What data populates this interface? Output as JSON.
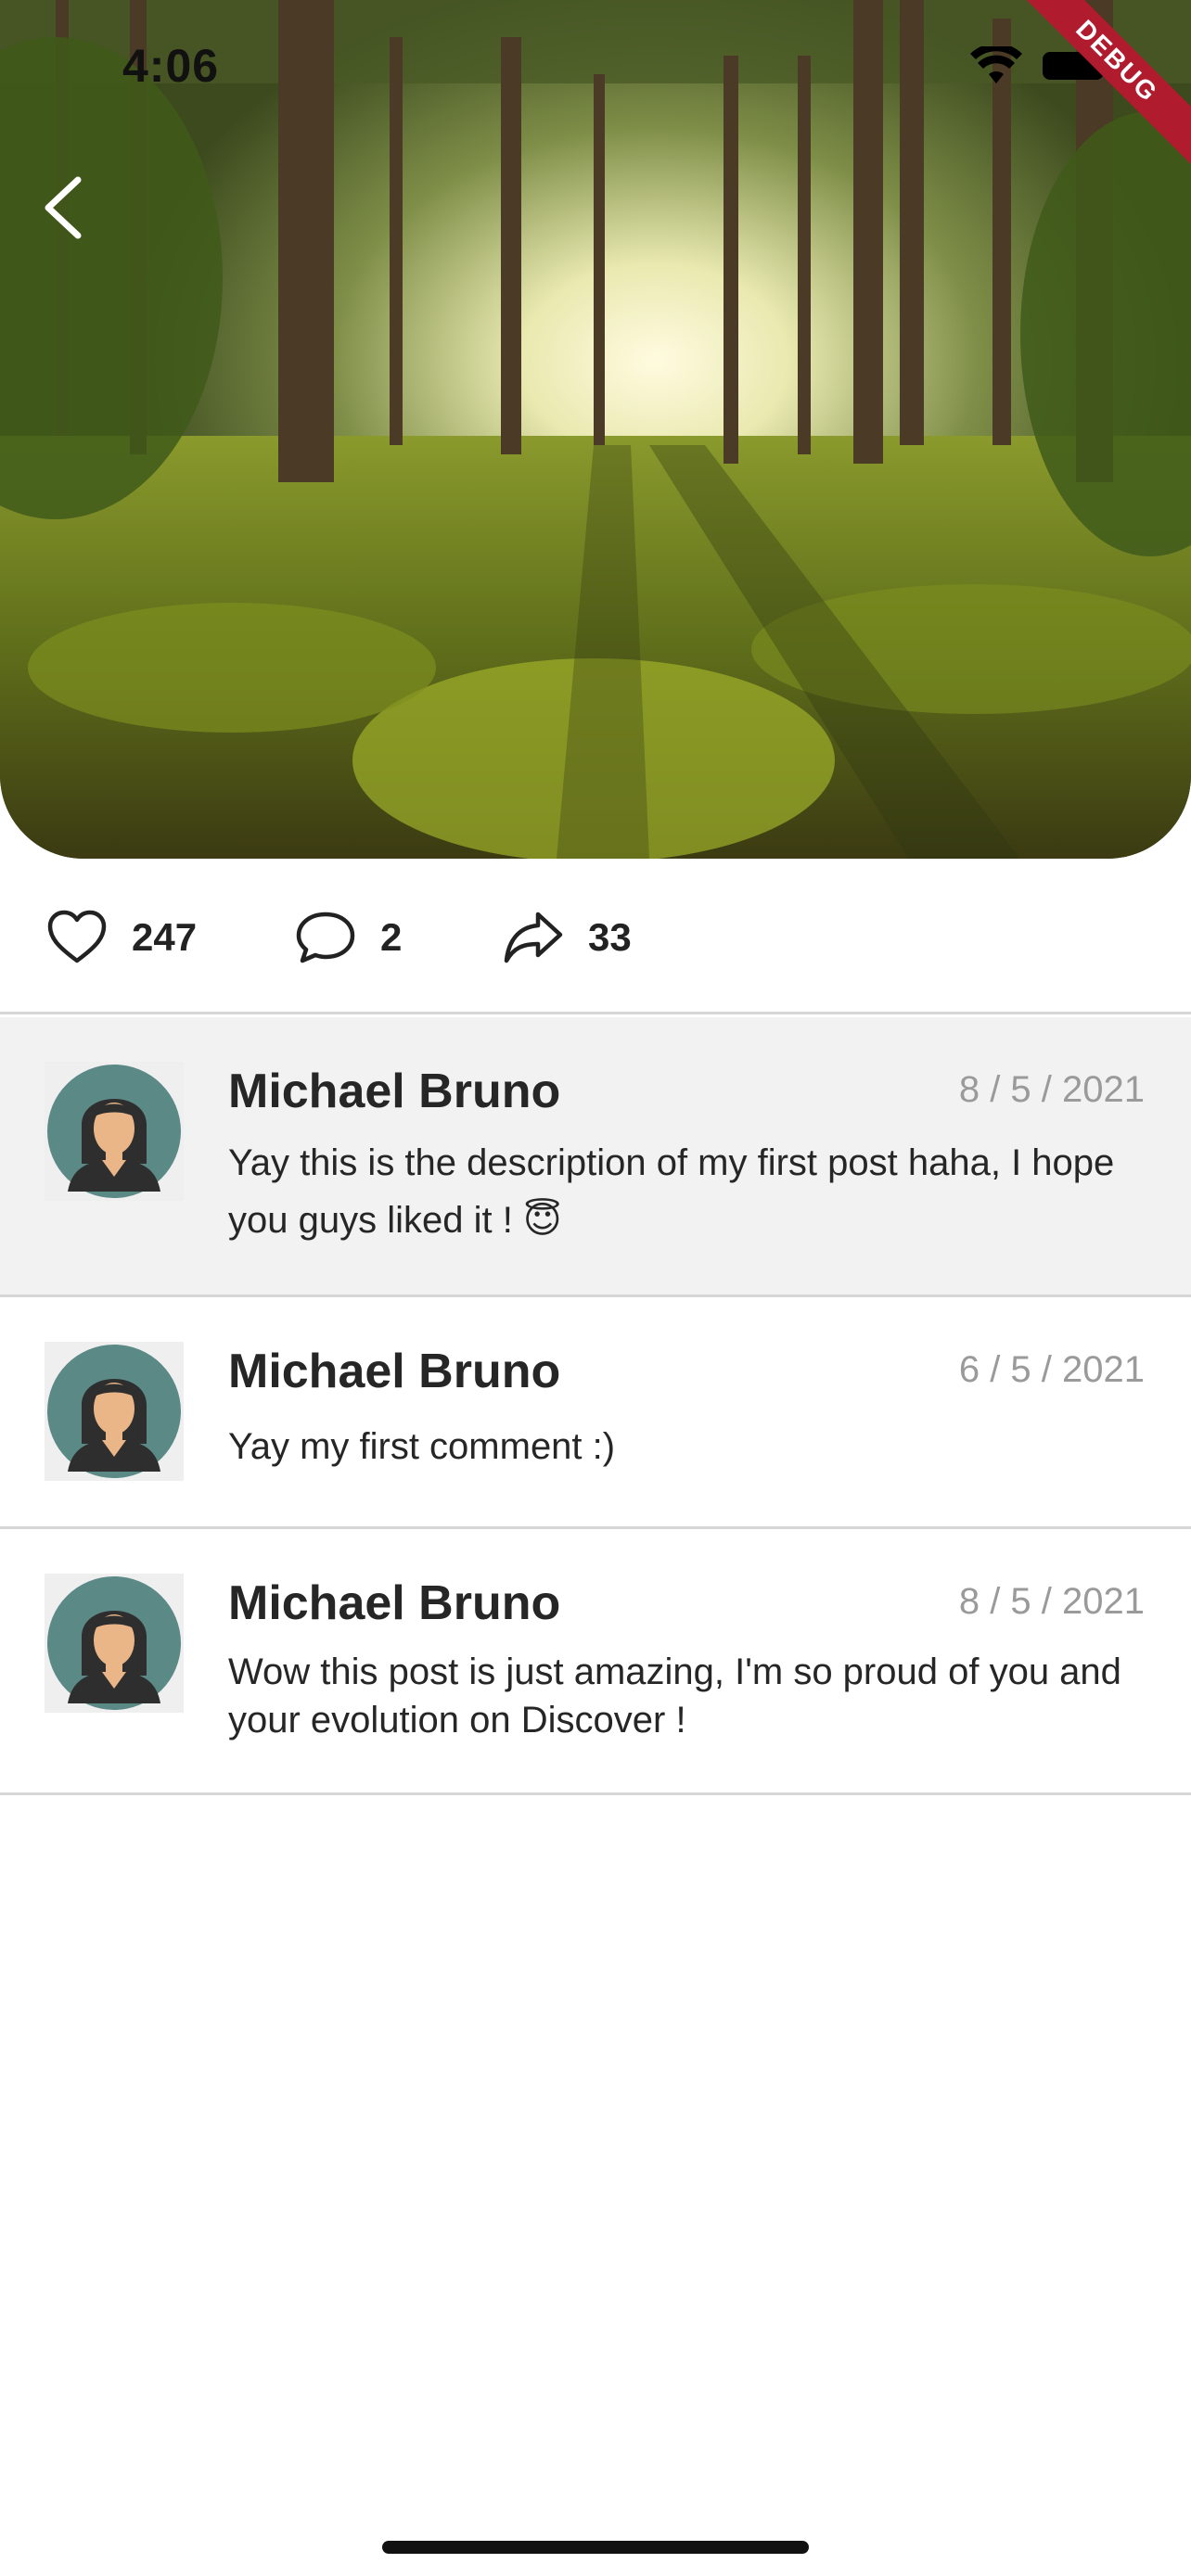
{
  "status_bar": {
    "time": "4:06",
    "debug_label": "DEBUG"
  },
  "post": {
    "image_icon": "forest-photo",
    "actions": {
      "likes": "247",
      "comments": "2",
      "shares": "33"
    }
  },
  "comments": [
    {
      "author": "Michael Bruno",
      "date": "8 / 5 / 2021",
      "text": "Yay this is the description of my first post haha, I hope you guys liked it ! 😇",
      "highlight": true
    },
    {
      "author": "Michael Bruno",
      "date": "6 / 5 / 2021",
      "text": "Yay my first comment :)"
    },
    {
      "author": "Michael Bruno",
      "date": "8 / 5 / 2021",
      "text": "Wow this post is just amazing, I'm so proud of you and your evolution on Discover !"
    }
  ],
  "colors": {
    "accent_debug": "#b01c2e",
    "avatar_bg": "#5b8986",
    "highlight_row": "#f2f2f2",
    "divider": "#d6d6d6"
  }
}
